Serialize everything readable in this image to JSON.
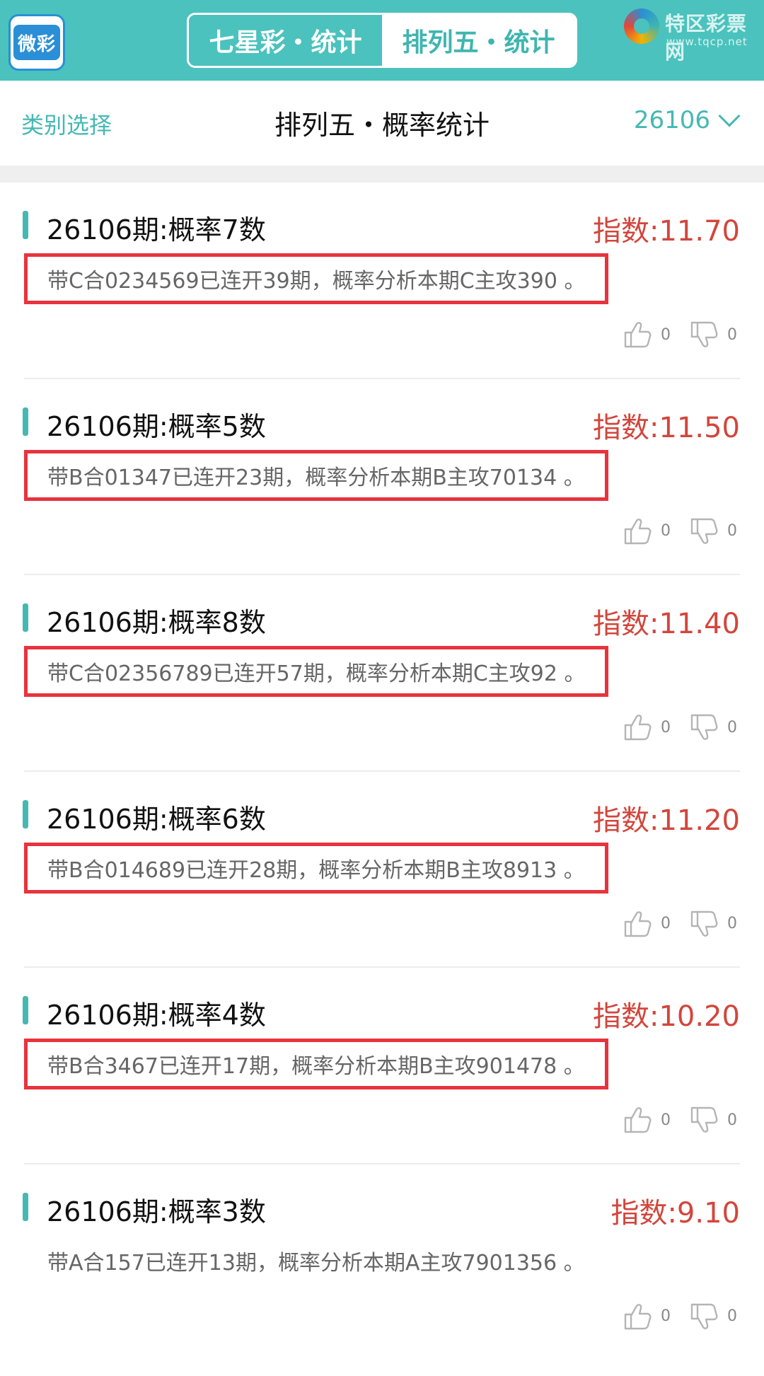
{
  "header": {
    "app_logo_text": "微彩",
    "tabs": [
      {
        "label": "七星彩・统计",
        "active": false
      },
      {
        "label": "排列五・统计",
        "active": true
      }
    ],
    "brand": {
      "name": "特区彩票网",
      "url": "www.tqcp.net"
    }
  },
  "subheader": {
    "category_label": "类别选择",
    "title": "排列五・概率统计",
    "issue": "26106"
  },
  "colors": {
    "accent": "#4bc2bd",
    "index_red": "#d2463c",
    "highlight_border": "#e8333d"
  },
  "cards": [
    {
      "title": "26106期:概率7数",
      "index": "指数:11.70",
      "desc": "带C合0234569已连开39期，概率分析本期C主攻390 。",
      "highlighted": true,
      "likes": "0",
      "dislikes": "0"
    },
    {
      "title": "26106期:概率5数",
      "index": "指数:11.50",
      "desc": "带B合01347已连开23期，概率分析本期B主攻70134 。",
      "highlighted": true,
      "likes": "0",
      "dislikes": "0"
    },
    {
      "title": "26106期:概率8数",
      "index": "指数:11.40",
      "desc": "带C合02356789已连开57期，概率分析本期C主攻92 。",
      "highlighted": true,
      "likes": "0",
      "dislikes": "0"
    },
    {
      "title": "26106期:概率6数",
      "index": "指数:11.20",
      "desc": "带B合014689已连开28期，概率分析本期B主攻8913 。",
      "highlighted": true,
      "likes": "0",
      "dislikes": "0"
    },
    {
      "title": "26106期:概率4数",
      "index": "指数:10.20",
      "desc": "带B合3467已连开17期，概率分析本期B主攻901478 。",
      "highlighted": true,
      "likes": "0",
      "dislikes": "0"
    },
    {
      "title": "26106期:概率3数",
      "index": "指数:9.10",
      "desc": "带A合157已连开13期，概率分析本期A主攻7901356 。",
      "highlighted": false,
      "likes": "0",
      "dislikes": "0"
    }
  ]
}
